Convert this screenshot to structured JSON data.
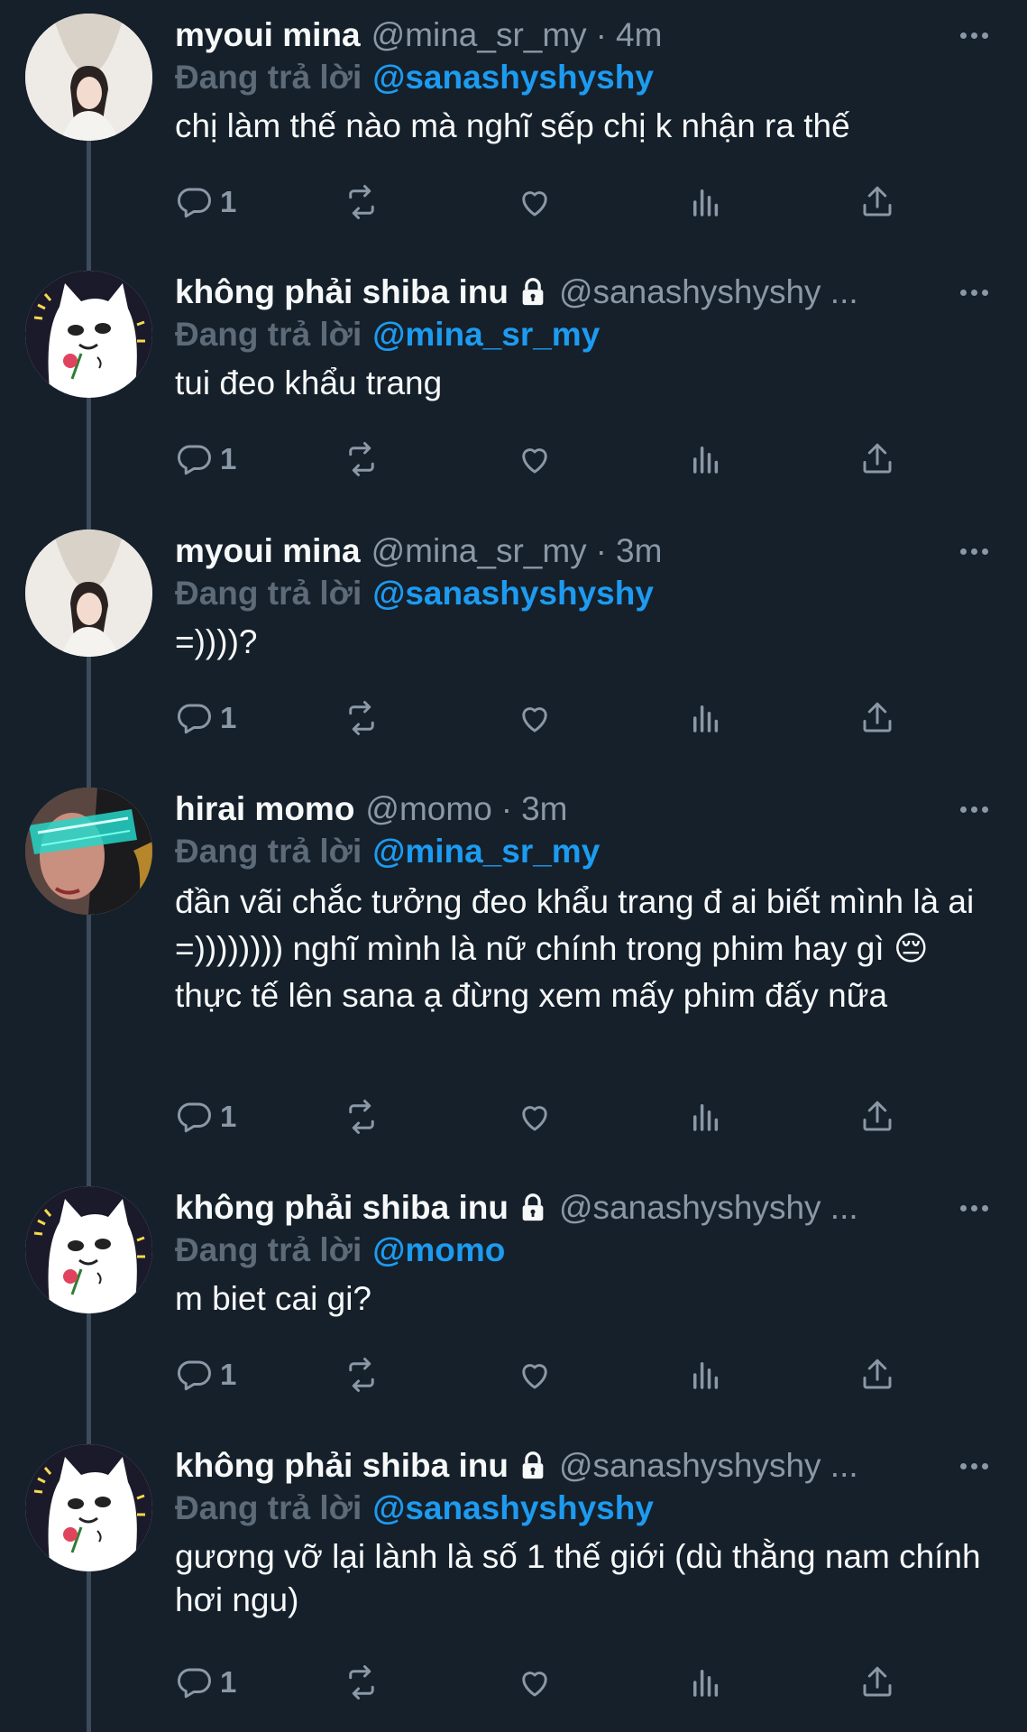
{
  "reply_prefix": "Đang trả lời",
  "tweets": [
    {
      "name": "myoui mina",
      "handle": "@mina_sr_my",
      "time": "4m",
      "reply_to": "@sanashyshyshy",
      "text": "chị làm thế nào mà nghĩ sếp chị k nhận ra thế",
      "reply_count": "1",
      "avatar": "mina"
    },
    {
      "name": "không phải shiba inu",
      "handle": "@sanashyshyshy ...",
      "reply_to": "@mina_sr_my",
      "text": "tui đeo khẩu trang",
      "reply_count": "1",
      "avatar": "shiba"
    },
    {
      "name": "myoui mina",
      "handle": "@mina_sr_my",
      "time": "3m",
      "reply_to": "@sanashyshyshy",
      "text": "=))))?",
      "reply_count": "1",
      "avatar": "mina"
    },
    {
      "name": "hirai momo",
      "handle": "@momo",
      "time": "3m",
      "reply_to": "@mina_sr_my",
      "text": "đần vãi chắc tưởng đeo khẩu trang đ ai biết mình là ai =)))))))) nghĩ mình là nữ chính trong phim hay gì 😔 thực tế lên sana ạ đừng xem mấy phim đấy nữa",
      "reply_count": "1",
      "avatar": "momo"
    },
    {
      "name": "không phải shiba inu",
      "handle": "@sanashyshyshy ...",
      "reply_to": "@momo",
      "text": "m biet cai gi?",
      "reply_count": "1",
      "avatar": "shiba"
    },
    {
      "name": "không phải shiba inu",
      "handle": "@sanashyshyshy ...",
      "reply_to": "@sanashyshyshy",
      "text": "gương vỡ lại lành là số 1 thế giới (dù thằng nam chính hơi ngu)",
      "reply_count": "1",
      "avatar": "shiba"
    }
  ],
  "colors": {
    "background": "#15202b",
    "accent": "#1d9bf0",
    "muted": "#8b98a5",
    "reply_label": "#5d6a77"
  },
  "icons": [
    "reply-icon",
    "retweet-icon",
    "like-icon",
    "views-icon",
    "share-icon",
    "more-icon",
    "lock-icon"
  ]
}
